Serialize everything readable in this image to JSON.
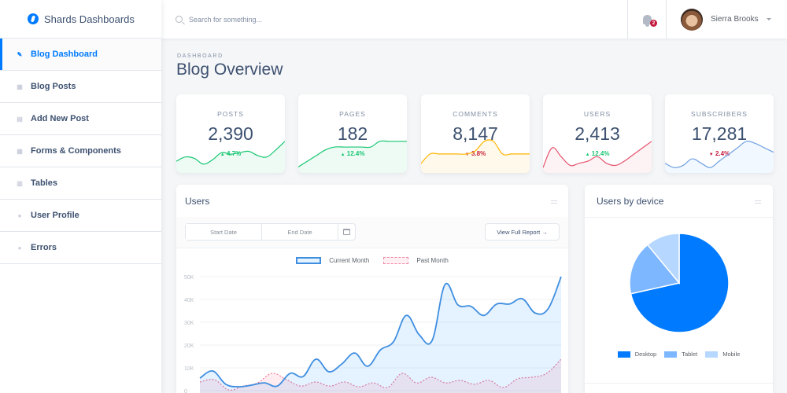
{
  "brand": {
    "name": "Shards Dashboards",
    "icon": "shards-logo-icon"
  },
  "sidebar": {
    "items": [
      {
        "label": "Blog Dashboard",
        "icon": "pencil-icon",
        "glyph": "✎",
        "active": true
      },
      {
        "label": "Blog Posts",
        "icon": "grid-icon",
        "glyph": "▦",
        "active": false
      },
      {
        "label": "Add New Post",
        "icon": "note-add-icon",
        "glyph": "▤",
        "active": false
      },
      {
        "label": "Forms & Components",
        "icon": "view-module-icon",
        "glyph": "▦",
        "active": false
      },
      {
        "label": "Tables",
        "icon": "table-icon",
        "glyph": "▥",
        "active": false
      },
      {
        "label": "User Profile",
        "icon": "person-icon",
        "glyph": "●",
        "active": false
      },
      {
        "label": "Errors",
        "icon": "error-icon",
        "glyph": "●",
        "active": false
      }
    ]
  },
  "header": {
    "search_placeholder": "Search for something...",
    "notifications_count": "2",
    "user_name": "Sierra Brooks"
  },
  "page": {
    "subtitle": "DASHBOARD",
    "title": "Blog Overview"
  },
  "stats": [
    {
      "label": "POSTS",
      "value": "2,390",
      "change": "4.7%",
      "direction": "up",
      "color": "#17c671",
      "fill": "rgba(23,198,113,0.08)",
      "spark": [
        3,
        4.5,
        4,
        2,
        3.5,
        6,
        5.5,
        6,
        6.5,
        5,
        4.5,
        7,
        10
      ]
    },
    {
      "label": "PAGES",
      "value": "182",
      "change": "12.4%",
      "direction": "up",
      "color": "#17c671",
      "fill": "rgba(23,198,113,0.08)",
      "spark": [
        1,
        3,
        5,
        7,
        8,
        8,
        8,
        8,
        8,
        10,
        10,
        10,
        10
      ]
    },
    {
      "label": "COMMENTS",
      "value": "8,147",
      "change": "3.8%",
      "direction": "down",
      "color": "#ffb400",
      "fill": "rgba(255,180,0,0.08)",
      "spark": [
        2,
        5,
        5,
        5,
        5,
        5,
        6,
        9,
        9,
        5,
        5,
        5,
        5
      ]
    },
    {
      "label": "USERS",
      "value": "2,413",
      "change": "12.4%",
      "direction": "up",
      "color": "#e5536d",
      "fill": "rgba(229,83,109,0.08)",
      "spark": [
        1,
        10,
        6,
        2,
        3,
        4,
        6,
        3,
        2,
        4,
        7,
        10,
        13
      ]
    },
    {
      "label": "SUBSCRIBERS",
      "value": "17,281",
      "change": "2.4%",
      "direction": "down",
      "color": "#6fa0e0",
      "fill": "rgba(0,123,255,0.05)",
      "spark": [
        3,
        1,
        2,
        5,
        3,
        1,
        4,
        7,
        10,
        13,
        12,
        10,
        8
      ]
    }
  ],
  "users_card": {
    "title": "Users",
    "start_date_placeholder": "Start Date",
    "end_date_placeholder": "End Date",
    "report_button": "View Full Report →"
  },
  "device_card": {
    "title": "Users by device"
  },
  "chart_data": [
    {
      "type": "line",
      "title": "Users",
      "xlabel": "",
      "ylabel": "",
      "ylim": [
        0,
        50000
      ],
      "yticks": [
        "0",
        "10K",
        "20K",
        "30K",
        "40K",
        "50K"
      ],
      "ytick_values": [
        0,
        10000,
        20000,
        30000,
        40000,
        50000
      ],
      "grid": true,
      "legend_position": "top-center",
      "series": [
        {
          "name": "Current Month",
          "color": "#007bff",
          "fill": "rgba(0,123,255,0.1)",
          "style": "solid",
          "values": [
            5500,
            8600,
            2800,
            1700,
            2400,
            3400,
            2000,
            7600,
            6200,
            13800,
            8300,
            11700,
            16500,
            10700,
            17900,
            21400,
            33000,
            24500,
            22000,
            46500,
            37600,
            37000,
            33000,
            38000,
            38000,
            40300,
            34000,
            36000,
            50000
          ]
        },
        {
          "name": "Past Month",
          "color": "#ff4169",
          "fill": "rgba(255,65,105,0.1)",
          "style": "dashed",
          "values": [
            3800,
            4800,
            300,
            2000,
            3400,
            7600,
            4800,
            2000,
            3800,
            2000,
            3800,
            1700,
            3400,
            1400,
            7600,
            3400,
            5900,
            3400,
            4500,
            2800,
            4500,
            1400,
            5200,
            5900,
            7600,
            13800
          ]
        }
      ]
    },
    {
      "type": "pie",
      "title": "Users by device",
      "legend_position": "bottom",
      "categories": [
        "Desktop",
        "Tablet",
        "Mobile"
      ],
      "values": [
        71.5,
        17.5,
        11
      ],
      "colors": [
        "#007bff",
        "#7db7ff",
        "#b6d7ff"
      ]
    }
  ]
}
